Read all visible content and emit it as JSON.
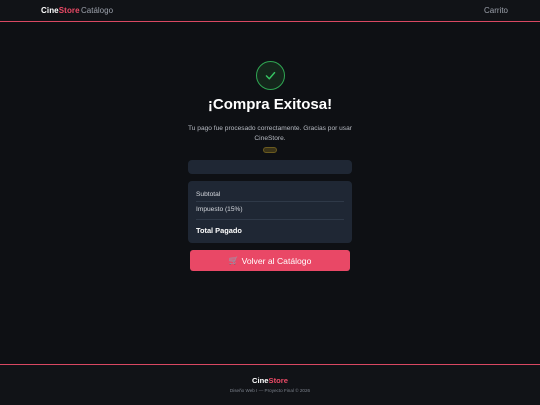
{
  "navbar": {
    "brand_part1": "Cine",
    "brand_part2": "Store",
    "catalog_label": "Catálogo",
    "cart_label": "Carrito"
  },
  "success": {
    "icon": "check-icon",
    "title": "¡Compra Exitosa!",
    "message": "Tu pago fue procesado correctamente. Gracias por usar CineStore."
  },
  "summary": {
    "subtotal_label": "Subtotal",
    "tax_label": "Impuesto (15%)",
    "total_label": "Total Pagado"
  },
  "actions": {
    "back_icon": "cart-icon",
    "back_label": "Volver al Catálogo"
  },
  "footer": {
    "brand_part1": "Cine",
    "brand_part2": "Store",
    "copyright": "Diseño Web I — Proyecto Final © 2026"
  },
  "colors": {
    "accent": "#e94866",
    "success": "#2fa552",
    "background": "#0e1014",
    "card": "#1f2734"
  }
}
